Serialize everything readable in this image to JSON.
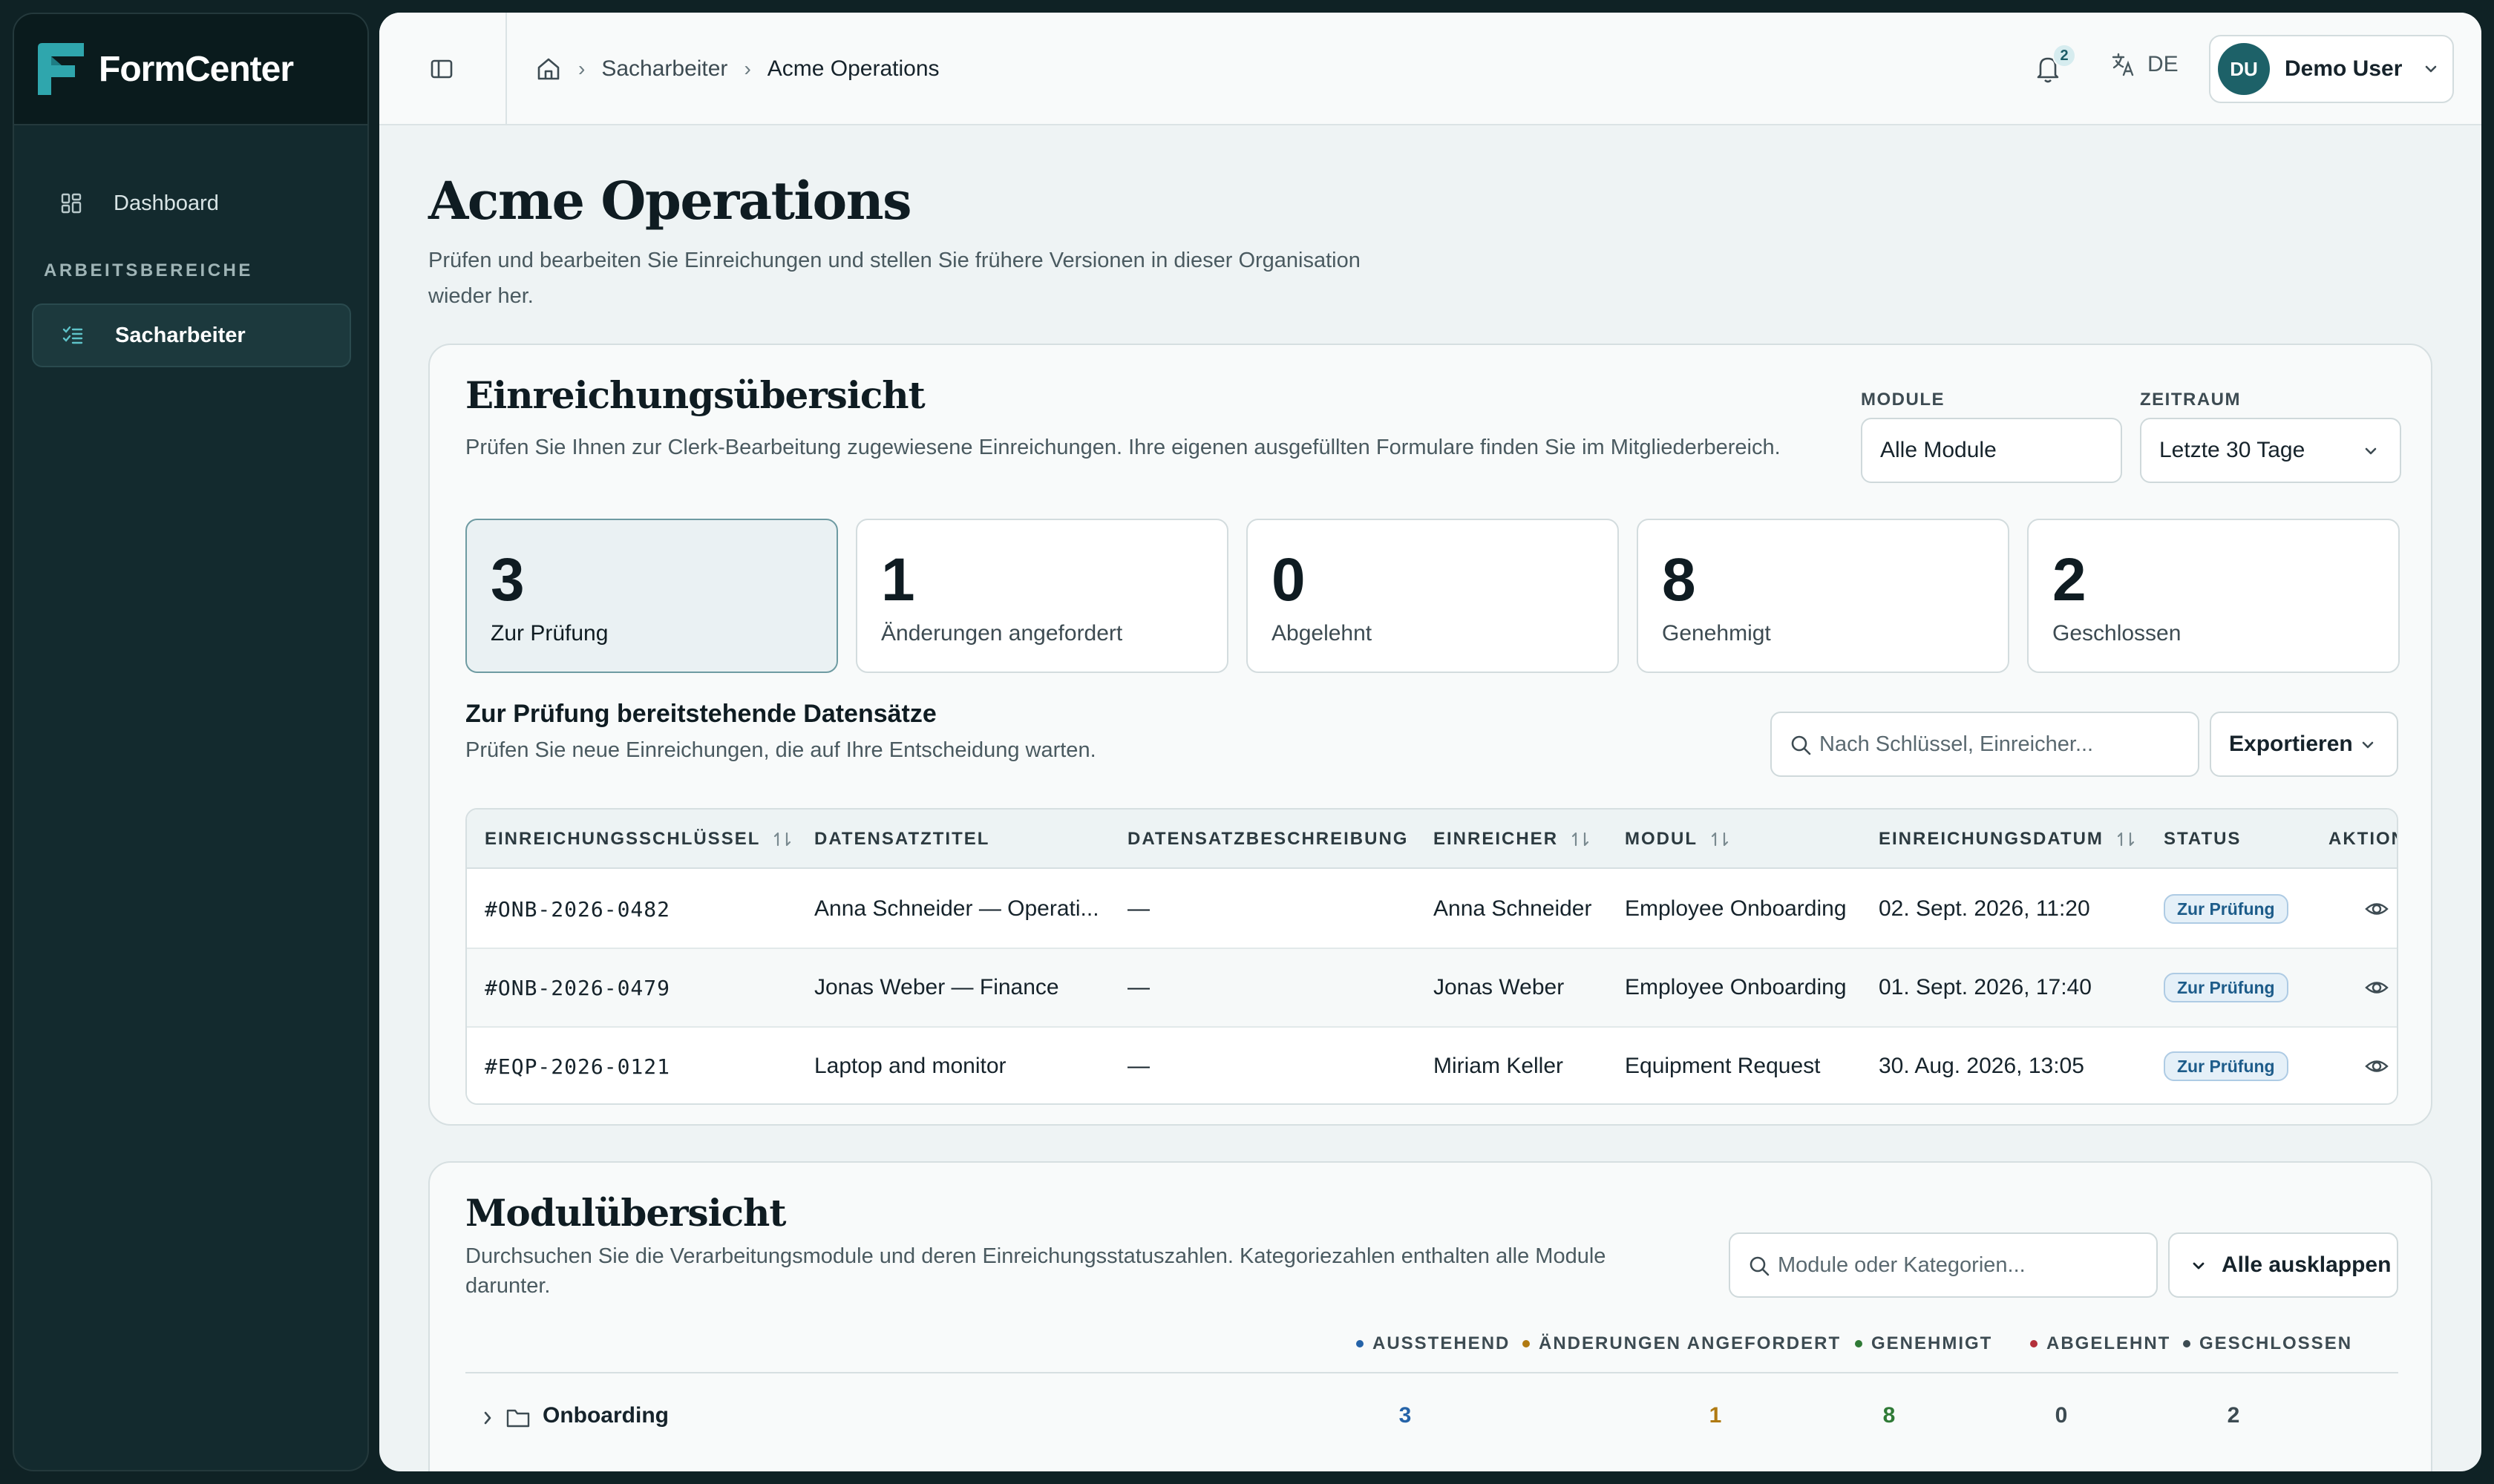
{
  "app": {
    "name": "FormCenter"
  },
  "sidebar": {
    "items": [
      {
        "label": "Dashboard",
        "icon": "grid-icon"
      }
    ],
    "section_title": "ARBEITSBEREICHE",
    "workspaces": [
      {
        "label": "Sacharbeiter",
        "icon": "checklist-icon",
        "active": true
      }
    ]
  },
  "topbar": {
    "breadcrumb": [
      "Sacharbeiter",
      "Acme Operations"
    ],
    "notifications_count": "2",
    "language": "DE",
    "user": {
      "initials": "DU",
      "name": "Demo User"
    }
  },
  "page": {
    "title": "Acme Operations",
    "description": "Prüfen und bearbeiten Sie Einreichungen und stellen Sie frühere Versionen in dieser Organisation wieder her."
  },
  "overview": {
    "title": "Einreichungsübersicht",
    "description": "Prüfen Sie Ihnen zur Clerk-Bearbeitung zugewiesene Einreichungen. Ihre eigenen ausgefüllten Formulare finden Sie im Mitgliederbereich.",
    "module_filter": {
      "label": "MODULE",
      "value": "Alle Module"
    },
    "period_filter": {
      "label": "ZEITRAUM",
      "value": "Letzte 30 Tage"
    },
    "stats": [
      {
        "value": "3",
        "label": "Zur Prüfung",
        "active": true
      },
      {
        "value": "1",
        "label": "Änderungen angefordert"
      },
      {
        "value": "0",
        "label": "Abgelehnt"
      },
      {
        "value": "8",
        "label": "Genehmigt"
      },
      {
        "value": "2",
        "label": "Geschlossen"
      }
    ],
    "section_title": "Zur Prüfung bereitstehende Datensätze",
    "section_description": "Prüfen Sie neue Einreichungen, die auf Ihre Entscheidung warten.",
    "search_placeholder": "Nach Schlüssel, Einreicher...",
    "export_label": "Exportieren",
    "table": {
      "columns": [
        "EINREICHUNGSSCHLÜSSEL",
        "DATENSATZTITEL",
        "DATENSATZBESCHREIBUNG",
        "EINREICHER",
        "MODUL",
        "EINREICHUNGSDATUM",
        "STATUS",
        "AKTION"
      ],
      "rows": [
        {
          "key": "#ONB-2026-0482",
          "title": "Anna Schneider — Operati...",
          "description": "—",
          "submitter": "Anna Schneider",
          "module": "Employee Onboarding",
          "date": "02. Sept. 2026, 11:20",
          "status": "Zur Prüfung"
        },
        {
          "key": "#ONB-2026-0479",
          "title": "Jonas Weber — Finance",
          "description": "—",
          "submitter": "Jonas Weber",
          "module": "Employee Onboarding",
          "date": "01. Sept. 2026, 17:40",
          "status": "Zur Prüfung"
        },
        {
          "key": "#EQP-2026-0121",
          "title": "Laptop and monitor",
          "description": "—",
          "submitter": "Miriam Keller",
          "module": "Equipment Request",
          "date": "30. Aug. 2026, 13:05",
          "status": "Zur Prüfung"
        }
      ]
    }
  },
  "modules": {
    "title": "Modulübersicht",
    "description": "Durchsuchen Sie die Verarbeitungsmodule und deren Einreichungsstatuszahlen. Kategoriezahlen enthalten alle Module darunter.",
    "search_placeholder": "Module oder Kategorien...",
    "expand_label": "Alle ausklappen",
    "legend": [
      {
        "label": "AUSSTEHEND",
        "color": "#2563a8"
      },
      {
        "label": "ÄNDERUNGEN ANGEFORDERT",
        "color": "#b07a12"
      },
      {
        "label": "GENEHMIGT",
        "color": "#2f7a36"
      },
      {
        "label": "ABGELEHNT",
        "color": "#b4303a"
      },
      {
        "label": "GESCHLOSSEN",
        "color": "#3d4b52"
      }
    ],
    "rows": [
      {
        "name": "Onboarding",
        "pending": "3",
        "changes": "1",
        "approved": "8",
        "rejected": "0",
        "closed": "2"
      }
    ]
  }
}
